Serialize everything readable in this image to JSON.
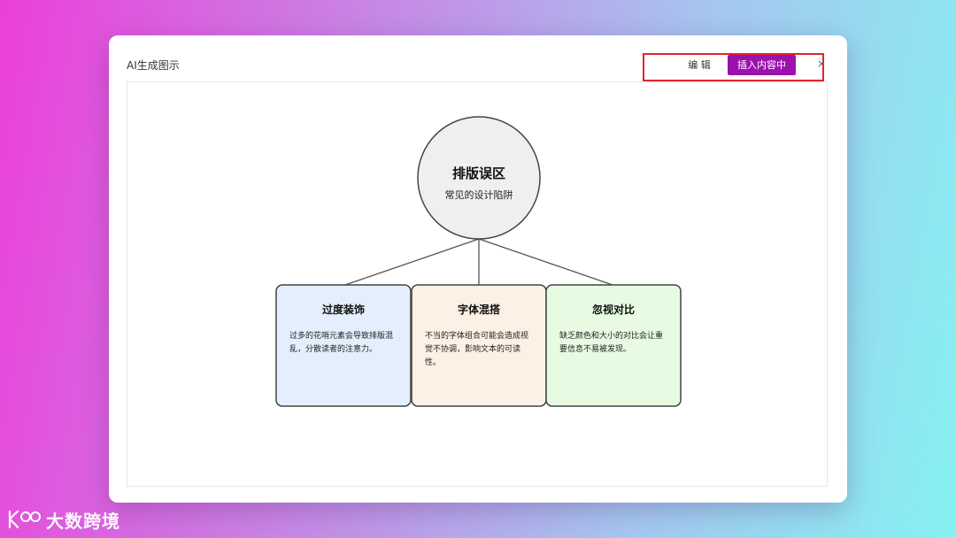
{
  "modal": {
    "title": "AI生成图示",
    "edit_label": "编 辑",
    "insert_label": "插入内容中",
    "close_symbol": "×"
  },
  "diagram": {
    "center": {
      "title": "排版误区",
      "subtitle": "常见的设计陷阱"
    },
    "boxes": [
      {
        "title": "过度装饰",
        "text": "过多的花哨元素会导致排版混乱，分散读者的注意力。",
        "color": "#e3effc"
      },
      {
        "title": "字体混搭",
        "text": "不当的字体组合可能会造成视觉不协调，影响文本的可读性。",
        "color": "#fdf0e4"
      },
      {
        "title": "忽视对比",
        "text": "缺乏颜色和大小的对比会让重要信息不易被发现。",
        "color": "#e7fbe2"
      }
    ]
  },
  "colors": {
    "insert_button": "#9a11ae",
    "highlight_border": "#e0262b",
    "center_fill": "#efefef"
  },
  "watermark": {
    "text": "大数跨境"
  }
}
